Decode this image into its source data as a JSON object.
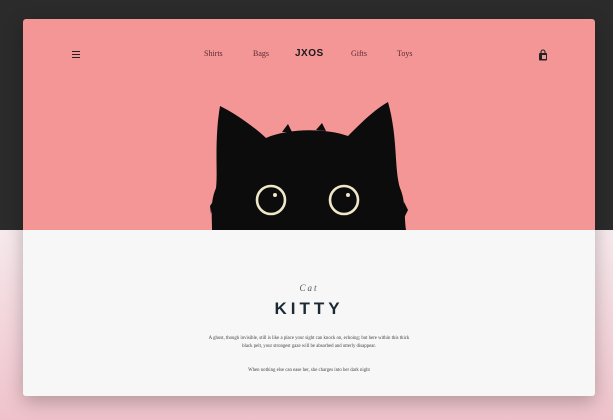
{
  "colors": {
    "hero_background": "#f49596",
    "content_background": "#f7f7f7",
    "frame_dark": "#2b2b2b",
    "cat": "#0c0c0c",
    "eye": "#efe7c8"
  },
  "nav": {
    "menu_icon": "hamburger-icon",
    "links_left": [
      "Shirts",
      "Bags"
    ],
    "logo": "JXOS",
    "links_right": [
      "Gifts",
      "Toys"
    ],
    "bag_icon": "shopping-bag-icon"
  },
  "hero": {
    "image": "black-cat-peeking-illustration"
  },
  "content": {
    "kicker": "Cat",
    "title": "KITTY",
    "body": "A ghost, though invisible, still is like a place your sight can knock on, echoing; but here within this thick black pelt, your strongest gaze will be absorbed and utterly disappear.",
    "footnote": "When nothing else can ease her, she charges into her dark night"
  }
}
